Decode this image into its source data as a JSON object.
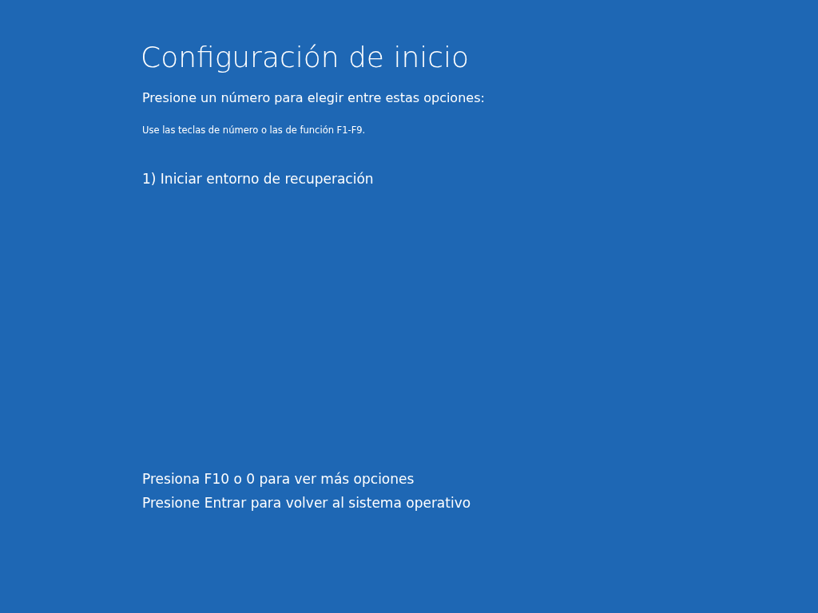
{
  "title": "Configuración de inicio",
  "prompt": "Presione un número para elegir entre estas opciones:",
  "hint": "Use las teclas de número o las de función F1-F9.",
  "options": [
    "1) Iniciar entorno de recuperación"
  ],
  "footer": [
    "Presiona F10 o 0 para ver más opciones",
    "Presione Entrar para volver al sistema operativo"
  ]
}
